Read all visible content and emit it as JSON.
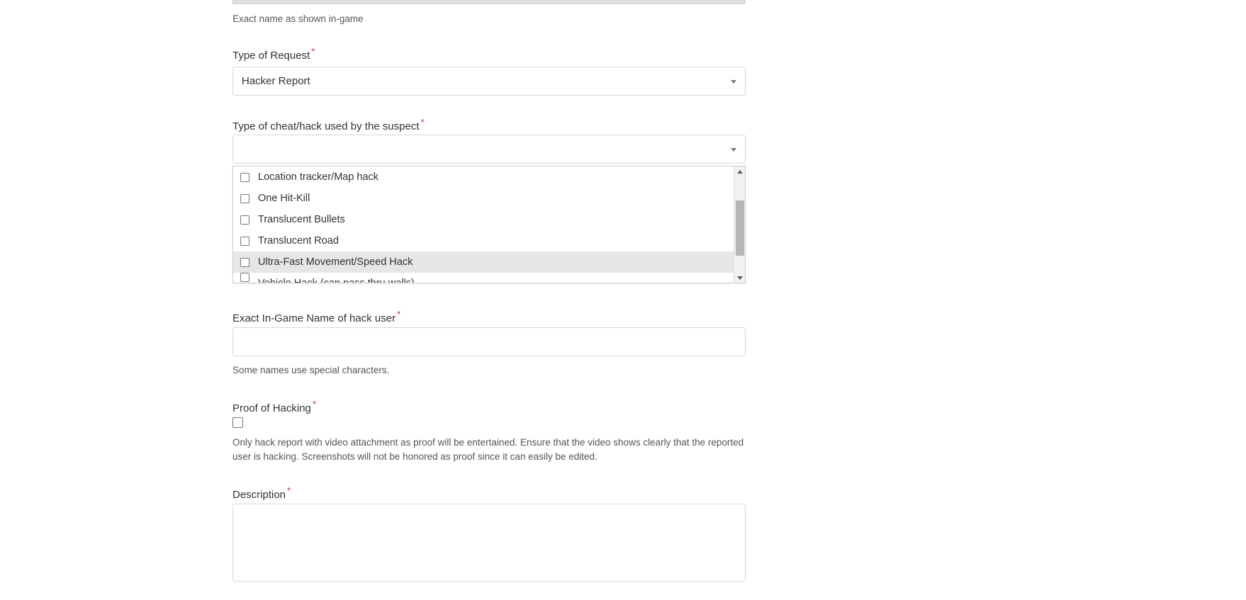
{
  "form": {
    "fields": {
      "ign_top": {
        "help_text": "Exact name as shown in-game",
        "value": ""
      },
      "type_of_request": {
        "label": "Type of Request",
        "required_marker": "*",
        "selected_value": "Hacker Report",
        "caret_icon": "chevron-down-icon"
      },
      "cheat_type": {
        "label": "Type of cheat/hack used by the suspect",
        "required_marker": "*",
        "selected_value": "",
        "placeholder": "",
        "caret_icon": "chevron-down-icon",
        "dropdown_open": true,
        "options": [
          {
            "label": "Location tracker/Map hack",
            "checked": false,
            "highlighted": false,
            "clipped": false
          },
          {
            "label": "One Hit-Kill",
            "checked": false,
            "highlighted": false,
            "clipped": false
          },
          {
            "label": "Translucent Bullets",
            "checked": false,
            "highlighted": false,
            "clipped": false
          },
          {
            "label": "Translucent Road",
            "checked": false,
            "highlighted": false,
            "clipped": false
          },
          {
            "label": "Ultra-Fast Movement/Speed Hack",
            "checked": false,
            "highlighted": true,
            "clipped": false
          },
          {
            "label": "Vehicle Hack (can pass thru walls)",
            "checked": false,
            "highlighted": false,
            "clipped": true
          }
        ],
        "scrollbar": {
          "up_arrow_icon": "caret-up-icon",
          "down_arrow_icon": "caret-down-icon"
        }
      },
      "hack_user_name": {
        "label": "Exact In-Game Name of hack user",
        "required_marker": "*",
        "value": "",
        "placeholder": "",
        "help_text": "Some names use special characters."
      },
      "proof_of_hacking": {
        "label": "Proof of Hacking",
        "required_marker": "*",
        "checked": false,
        "help_text": "Only hack report with video attachment as proof will be entertained. Ensure that the video shows clearly that the reported user is hacking. Screenshots will not be honored as proof since it can easily be edited."
      },
      "description": {
        "label": "Description",
        "required_marker": "*",
        "value": "",
        "placeholder": ""
      }
    }
  },
  "colors": {
    "required_asterisk": "#c0392b",
    "border": "#d8d8d8",
    "highlight_row": "#e6e6e6",
    "scrollbar_thumb": "#b6b6b6",
    "text": "#333333",
    "help_text": "#555555"
  }
}
